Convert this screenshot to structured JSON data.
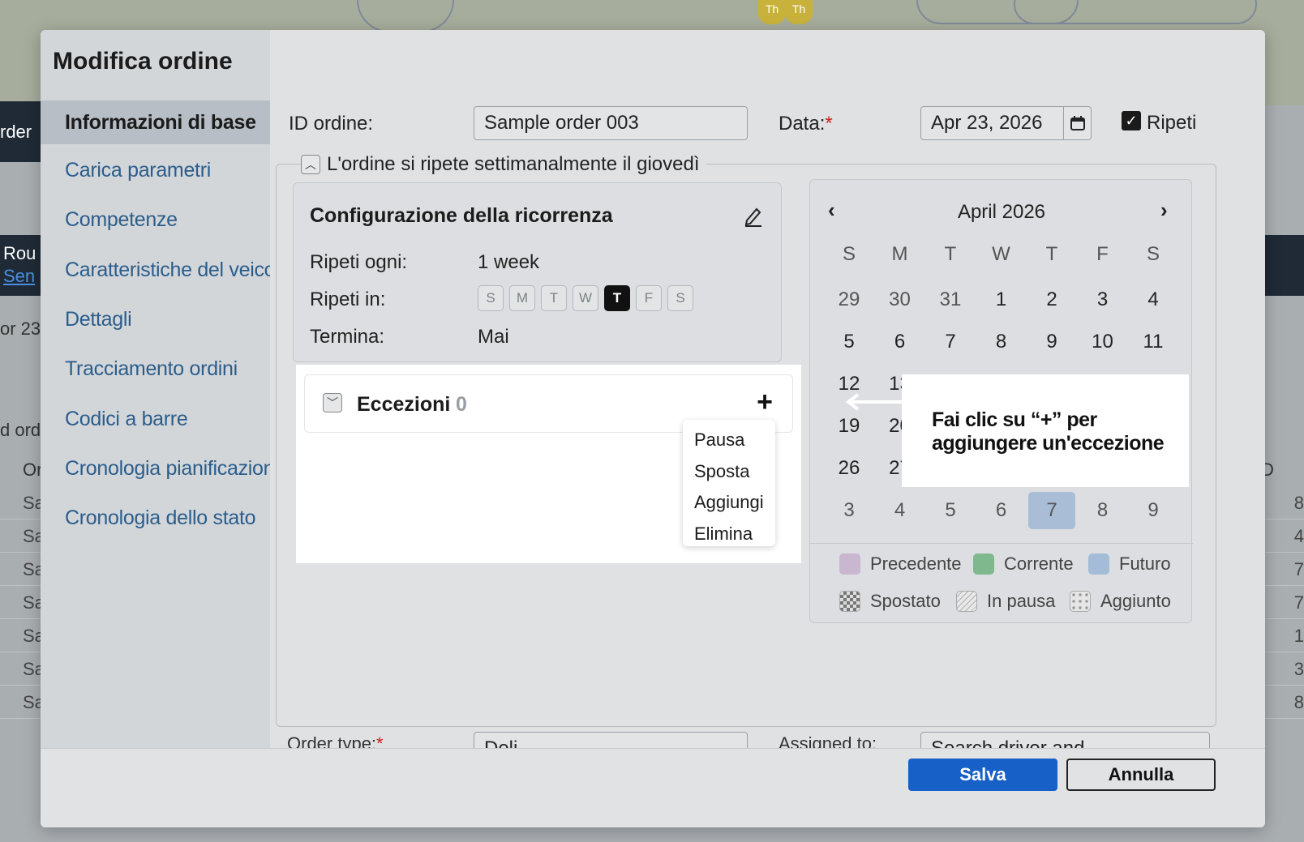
{
  "background": {
    "map_pins": [
      "Th",
      "Th"
    ],
    "fragments": [
      "rder",
      "Rou",
      "Sen",
      "or 23",
      "d ord",
      "Or",
      "D"
    ],
    "row_left": [
      "Sa",
      "Sa",
      "Sa",
      "Sa",
      "Sa",
      "Sa",
      "Sa"
    ],
    "row_right": [
      "8",
      "4",
      "7",
      "7",
      "1",
      "3",
      "8"
    ]
  },
  "dialog": {
    "title": "Modifica ordine",
    "nav": [
      {
        "label": "Informazioni di base",
        "active": true
      },
      {
        "label": "Carica parametri"
      },
      {
        "label": "Competenze"
      },
      {
        "label": "Caratteristiche del veicolo"
      },
      {
        "label": "Dettagli"
      },
      {
        "label": "Tracciamento ordini"
      },
      {
        "label": "Codici a barre"
      },
      {
        "label": "Cronologia pianificazione"
      },
      {
        "label": "Cronologia dello stato"
      }
    ],
    "order_id_label": "ID ordine:",
    "order_id_value": "Sample order 003",
    "date_label": "Data:",
    "date_required": "*",
    "date_value": "Apr 23, 2026",
    "repeat_label": "Ripeti",
    "repeat_checked": true,
    "recurrence_summary": "L'ordine si ripete settimanalmente il giovedì",
    "config": {
      "title": "Configurazione della ricorrenza",
      "every_label": "Ripeti ogni:",
      "every_value": "1 week",
      "on_label": "Ripeti in:",
      "days": [
        "S",
        "M",
        "T",
        "W",
        "T",
        "F",
        "S"
      ],
      "selected_day_index": 4,
      "ends_label": "Termina:",
      "ends_value": "Mai"
    },
    "exceptions": {
      "title": "Eccezioni",
      "count": "0",
      "add_symbol": "+",
      "menu": [
        "Pausa",
        "Sposta",
        "Aggiungi",
        "Elimina"
      ]
    },
    "calendar": {
      "month": "April 2026",
      "weekdays": [
        "S",
        "M",
        "T",
        "W",
        "T",
        "F",
        "S"
      ],
      "weeks": [
        [
          "29",
          "30",
          "31",
          "1",
          "2",
          "3",
          "4"
        ],
        [
          "5",
          "6",
          "7",
          "8",
          "9",
          "10",
          "11"
        ],
        [
          "12",
          "13",
          "",
          "",
          "",
          "",
          ""
        ],
        [
          "19",
          "20",
          "",
          "",
          "",
          "",
          ""
        ],
        [
          "26",
          "27",
          "",
          "",
          "",
          "",
          ""
        ],
        [
          "3",
          "4",
          "5",
          "6",
          "7",
          "8",
          "9"
        ]
      ],
      "selected": "7",
      "legend": [
        {
          "label": "Precedente",
          "color": "#c9b6cf"
        },
        {
          "label": "Corrente",
          "color": "#7fb88c"
        },
        {
          "label": "Futuro",
          "color": "#a4bcd8"
        },
        {
          "label": "Spostato",
          "pattern": "checker"
        },
        {
          "label": "In pausa",
          "pattern": "hatch"
        },
        {
          "label": "Aggiunto",
          "pattern": "dotted"
        }
      ]
    },
    "callout": "Fai clic su “+” per aggiungere un'eccezione",
    "partial_row": {
      "order_type_label": "Order type:",
      "order_type_required": "*",
      "order_type_value": "Deli",
      "assigned_label": "Assigned to:",
      "assigned_value": "Search driver and..."
    },
    "buttons": {
      "save": "Salva",
      "cancel": "Annulla"
    }
  },
  "colors": {
    "accent": "#1660c7",
    "link": "#2b5d8c",
    "required": "#cc1f1f",
    "selected_day": "#a9bdd6"
  }
}
